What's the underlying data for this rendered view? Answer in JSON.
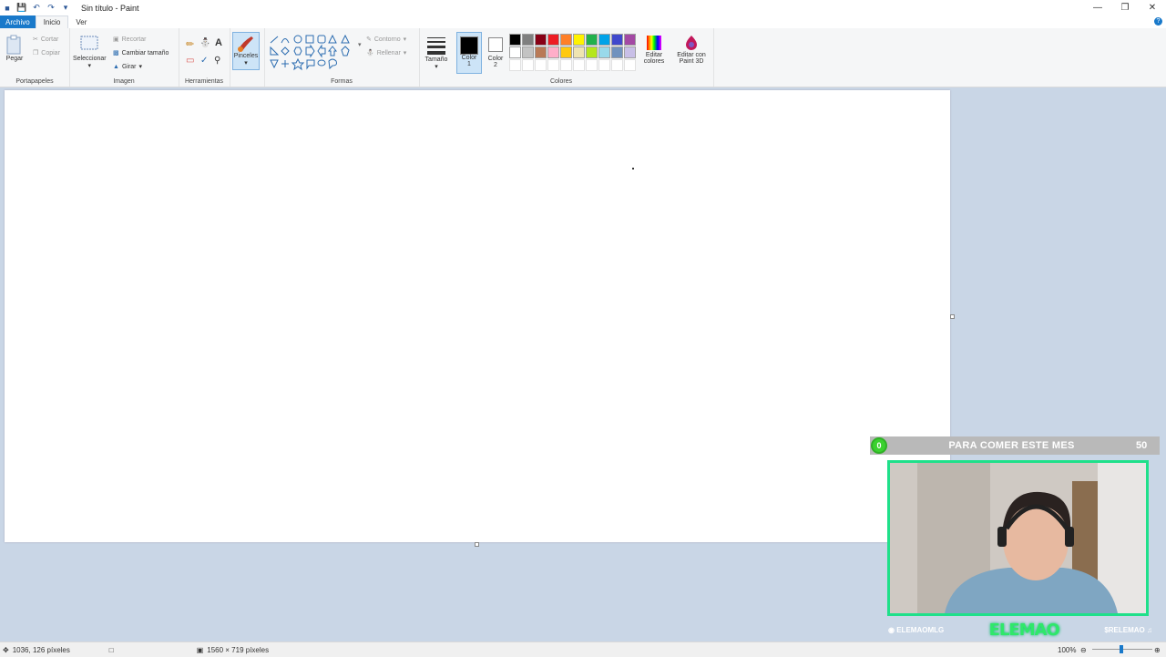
{
  "window": {
    "title": "Sin título - Paint"
  },
  "menu": {
    "archivo": "Archivo",
    "tabs": [
      "Inicio",
      "Ver"
    ]
  },
  "ribbon": {
    "portapapeles": {
      "label": "Portapapeles",
      "pegar": "Pegar",
      "cortar": "Cortar",
      "copiar": "Copiar"
    },
    "imagen": {
      "label": "Imagen",
      "seleccionar": "Seleccionar",
      "recortar": "Recortar",
      "cambiar_tamano": "Cambiar tamaño",
      "girar": "Girar"
    },
    "herramientas": {
      "label": "Herramientas"
    },
    "pinceles": {
      "label": "Pinceles"
    },
    "formas": {
      "label": "Formas",
      "contorno": "Contorno",
      "rellenar": "Rellenar"
    },
    "tamano": {
      "label": "Tamaño"
    },
    "color1": {
      "label": "Color 1",
      "value": "#000000"
    },
    "color2": {
      "label": "Color 2",
      "value": "#ffffff"
    },
    "colores": {
      "label": "Colores",
      "row1": [
        "#000000",
        "#7f7f7f",
        "#880015",
        "#ed1c24",
        "#ff7f27",
        "#fff200",
        "#22b14c",
        "#00a2e8",
        "#3f48cc",
        "#a349a4"
      ],
      "row2": [
        "#ffffff",
        "#c3c3c3",
        "#b97a57",
        "#ffaec9",
        "#ffc90e",
        "#efe4b0",
        "#b5e61d",
        "#99d9ea",
        "#7092be",
        "#c8bfe7"
      ]
    },
    "editar_colores": "Editar colores",
    "paint3d": "Editar con Paint 3D"
  },
  "status": {
    "cursor": "1036, 126 píxeles",
    "size": "1560 × 719 píxeles",
    "zoom": "100%"
  },
  "overlay": {
    "counter": "0",
    "text": "PARA COMER ESTE MES",
    "goal": "50"
  },
  "socials": {
    "instagram": "ELEMAOMLG",
    "logo": "ELEMAO",
    "tiktok": "$RELEMAO"
  }
}
